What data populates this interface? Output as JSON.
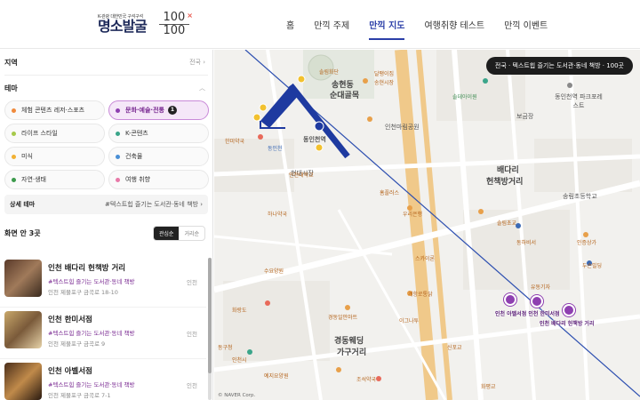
{
  "header": {
    "logo_subtitle": "K-관광 대한민국 구석구석",
    "logo_title": "명소발굴",
    "logo_badge_top": "100",
    "logo_badge_bottom": "100",
    "logo_badge_x": "×",
    "nav": [
      {
        "label": "홈",
        "active": false
      },
      {
        "label": "만끽 주제",
        "active": false
      },
      {
        "label": "만끽 지도",
        "active": true
      },
      {
        "label": "여행취향 테스트",
        "active": false
      },
      {
        "label": "만끽 이벤트",
        "active": false
      }
    ]
  },
  "sidebar": {
    "region_label": "지역",
    "region_value": "전국",
    "theme_label": "테마",
    "themes": [
      {
        "label": "체험 콘텐츠 레저·스포츠",
        "color": "#f08a3c"
      },
      {
        "label": "문화·예술·전통",
        "color": "#8e3fb0",
        "active": true,
        "count": "1"
      },
      {
        "label": "라이프 스타일",
        "color": "#a6c94a"
      },
      {
        "label": "K-콘텐츠",
        "color": "#3aa58a"
      },
      {
        "label": "미식",
        "color": "#f2b134"
      },
      {
        "label": "건축물",
        "color": "#4a8fd6"
      },
      {
        "label": "자연·생태",
        "color": "#3c9a4c"
      },
      {
        "label": "여행 취향",
        "color": "#e879a8"
      }
    ],
    "detail_theme_label": "상세 테마",
    "detail_theme_value": "#텍스트힙 즐기는 도서관·동네 책방",
    "count_label": "화면 안 3곳",
    "sort_options": [
      "관심순",
      "거리순"
    ],
    "places": [
      {
        "name": "인천 배다리 헌책방 거리",
        "tag": "#텍스트힙 즐기는 도서관·동네 책방",
        "address": "인천 제물포구 금곡로 18-10",
        "city": "인천"
      },
      {
        "name": "인천 한미서점",
        "tag": "#텍스트힙 즐기는 도서관·동네 책방",
        "address": "인천 제물포구 금곡로 9",
        "city": "인천"
      },
      {
        "name": "인천 아벨서점",
        "tag": "#텍스트힙 즐기는 도서관·동네 책방",
        "address": "인천 제물포구 금곡로 7-1",
        "city": "인천"
      }
    ]
  },
  "map": {
    "badge": "전국 · 텍스트힙 즐기는 도서관·동네 책방 · 100곳",
    "labels": {
      "songhyeon": "송현동",
      "sundae": "순대골목",
      "baedari": "배다리",
      "books": "헌책방거리",
      "gyeongdong": "경동웨딩",
      "gagu": "가구거리",
      "dongincheon": "동인천역",
      "incheon_mail": "인천마림공원",
      "songnim": "송림초등학교",
      "dongui": "동인천역 파크포레스트",
      "bokjang": "보금장",
      "hyundai": "현대시장"
    },
    "pois": [
      "달팽이집",
      "송현시장",
      "솔데아이원",
      "솔림화단",
      "홈플러스",
      "우리은행",
      "한미약국",
      "인천대학교",
      "동인천",
      "수요양원",
      "경동일안마트",
      "개항로통닭",
      "이그나투",
      "하나약국",
      "유동기자",
      "스카이론",
      "솔림초교",
      "신포교",
      "화랑도",
      "동구청",
      "인천시",
      "화평교",
      "두손빌딩",
      "인증상가",
      "예지요양원",
      "조석약국",
      "동하비서"
    ],
    "markers": [
      {
        "label": "인천 아벨서점",
        "sub": "인천 한미서점"
      },
      {
        "label": "인천 배다리 헌책방 거리"
      }
    ],
    "copyright": "© NAVER Corp."
  }
}
